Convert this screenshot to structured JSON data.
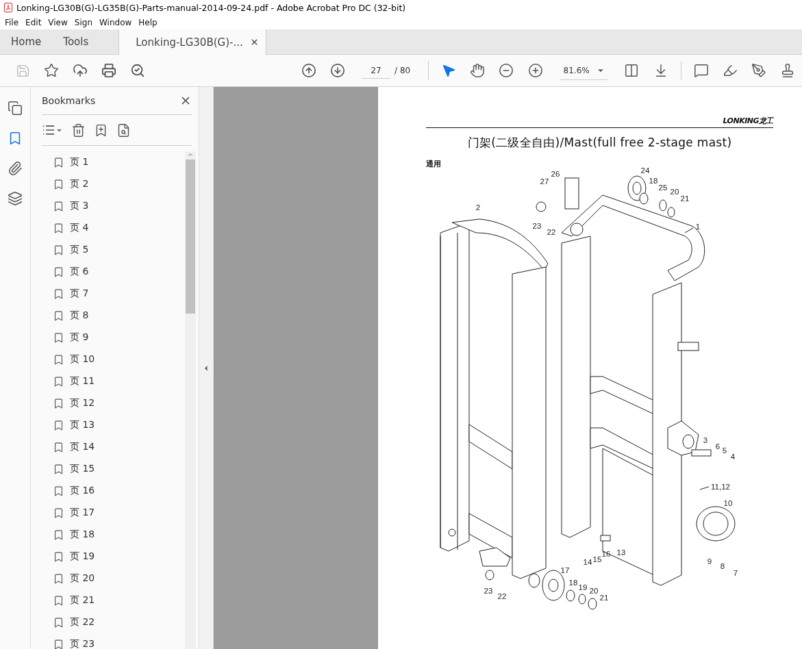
{
  "window": {
    "title": "Lonking-LG30B(G)-LG35B(G)-Parts-manual-2014-09-24.pdf - Adobe Acrobat Pro DC (32-bit)"
  },
  "menu": [
    "File",
    "Edit",
    "View",
    "Sign",
    "Window",
    "Help"
  ],
  "tabs": [
    {
      "label": "Home",
      "selected": false,
      "closable": false
    },
    {
      "label": "Tools",
      "selected": false,
      "closable": false
    },
    {
      "label": "Lonking-LG30B(G)-...",
      "selected": true,
      "closable": true
    }
  ],
  "toolbar": {
    "save_disabled": true,
    "page_value": "27",
    "page_total": "/ 80",
    "zoom": "81.6%"
  },
  "side_tabs": [
    {
      "kind": "pages",
      "selected": false
    },
    {
      "kind": "bookmarks",
      "selected": true
    },
    {
      "kind": "attachments",
      "selected": false
    },
    {
      "kind": "layers",
      "selected": false
    }
  ],
  "bookmarks": {
    "title": "Bookmarks",
    "items": [
      "页 1",
      "页 2",
      "页 3",
      "页 4",
      "页 5",
      "页 6",
      "页 7",
      "页 8",
      "页 9",
      "页 10",
      "页 11",
      "页 12",
      "页 13",
      "页 14",
      "页 15",
      "页 16",
      "页 17",
      "页 18",
      "页 19",
      "页 20",
      "页 21",
      "页 22",
      "页 23"
    ]
  },
  "page": {
    "logo": "LONKING龙工",
    "title": "门架(二级全自由)/Mast(full free 2-stage mast)",
    "note": "通用",
    "callouts": [
      "26",
      "27",
      "24",
      "18",
      "25",
      "20",
      "21",
      "2",
      "23",
      "22",
      "1",
      "3",
      "6",
      "5",
      "4",
      "11,12",
      "10",
      "13",
      "16",
      "15",
      "14",
      "9",
      "8",
      "7",
      "17",
      "18",
      "19",
      "20",
      "21",
      "23",
      "22"
    ]
  }
}
